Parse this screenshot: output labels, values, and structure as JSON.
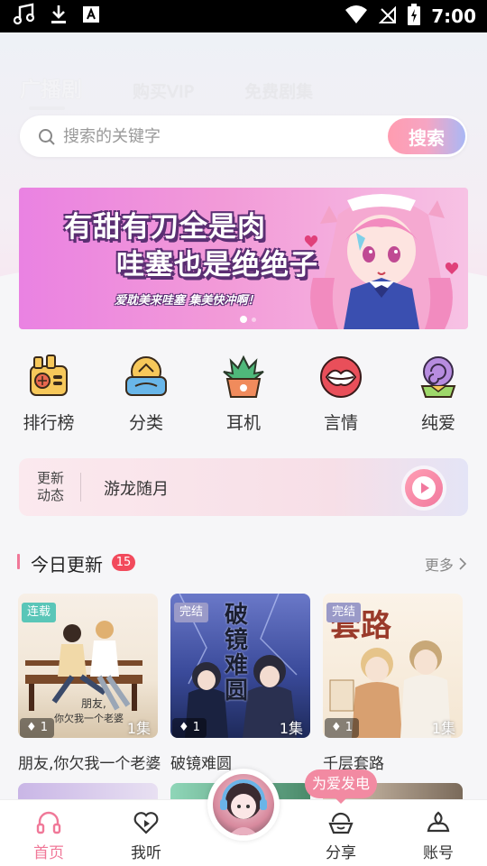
{
  "status_bar": {
    "time": "7:00"
  },
  "tabs": [
    {
      "label": "广播剧",
      "active": true
    },
    {
      "label": "购买VIP",
      "active": false
    },
    {
      "label": "免费剧集",
      "active": false
    }
  ],
  "search": {
    "placeholder": "搜索的关键字",
    "button_label": "搜索"
  },
  "banner": {
    "line1": "有甜有刀全是肉",
    "line2": "哇塞也是绝绝子",
    "subtitle": "爱耽美来哇塞 集美快冲啊！"
  },
  "categories": [
    {
      "label": "排行榜",
      "icon": "radio-icon"
    },
    {
      "label": "分类",
      "icon": "category-icon"
    },
    {
      "label": "耳机",
      "icon": "succulent-icon"
    },
    {
      "label": "言情",
      "icon": "lips-icon"
    },
    {
      "label": "纯爱",
      "icon": "lollipop-icon"
    }
  ],
  "news": {
    "tag": "更新动态",
    "text": "游龙随月"
  },
  "today": {
    "title": "今日更新",
    "badge": "15",
    "more": "更多",
    "items": [
      {
        "tag": "连载",
        "count": "1",
        "eps": "1集",
        "title": "朋友,你欠我一个老婆"
      },
      {
        "tag": "完结",
        "count": "1",
        "eps": "1集",
        "title": "破镜难圆",
        "cover_text": "破镜难圆"
      },
      {
        "tag": "完结",
        "count": "1",
        "eps": "1集",
        "title": "千层套路",
        "cover_text": "套路"
      }
    ]
  },
  "share_bubble": "为爱发电",
  "nav": [
    {
      "label": "首页",
      "icon": "headphones-icon",
      "active": true
    },
    {
      "label": "我听",
      "icon": "heart-play-icon",
      "active": false
    },
    {
      "label": "分享",
      "icon": "share-cloud-icon",
      "active": false
    },
    {
      "label": "账号",
      "icon": "account-icon",
      "active": false
    }
  ],
  "colors": {
    "accent": "#f07898",
    "badge": "#f24a5c",
    "banner_start": "#ea82e2"
  }
}
